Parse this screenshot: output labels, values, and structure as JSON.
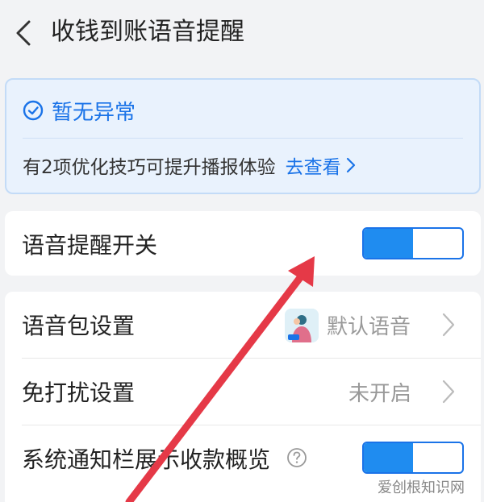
{
  "header": {
    "title": "收钱到账语音提醒",
    "back_icon": "chevron-left-icon"
  },
  "status": {
    "title": "暂无异常",
    "icon": "check-circle-icon",
    "tip": "有2项优化技巧可提升播报体验",
    "link": "去查看"
  },
  "settings": {
    "voice_switch": {
      "label": "语音提醒开关",
      "enabled": true
    },
    "voice_pack": {
      "label": "语音包设置",
      "value": "默认语音"
    },
    "do_not_disturb": {
      "label": "免打扰设置",
      "value": "未开启"
    },
    "notification_summary": {
      "label": "系统通知栏展示收款概览",
      "enabled": true
    }
  },
  "colors": {
    "accent": "#1a73e8",
    "arrow": "#e53947"
  },
  "watermark": "爱创根知识网"
}
